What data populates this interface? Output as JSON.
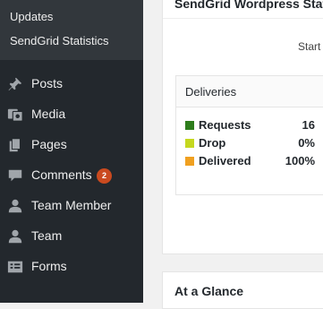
{
  "sidebar": {
    "submenu": [
      "Updates",
      "SendGrid Statistics"
    ],
    "items": [
      {
        "label": "Posts",
        "icon": "pin-icon"
      },
      {
        "label": "Media",
        "icon": "media-icon"
      },
      {
        "label": "Pages",
        "icon": "pages-icon"
      },
      {
        "label": "Comments",
        "icon": "comments-icon",
        "badge": "2"
      },
      {
        "label": "Team Member",
        "icon": "user-icon"
      },
      {
        "label": "Team",
        "icon": "user-icon"
      },
      {
        "label": "Forms",
        "icon": "forms-icon"
      }
    ]
  },
  "main": {
    "sendgrid_title": "SendGrid Wordpress Statis",
    "start_label": "Start",
    "deliveries": {
      "title": "Deliveries",
      "rows": [
        {
          "label": "Requests",
          "value": "16",
          "color": "#2e7d1c"
        },
        {
          "label": "Drop",
          "value": "0%",
          "color": "#c5d81f"
        },
        {
          "label": "Delivered",
          "value": "100%",
          "color": "#f0a020"
        }
      ]
    },
    "glance_title": "At a Glance"
  }
}
